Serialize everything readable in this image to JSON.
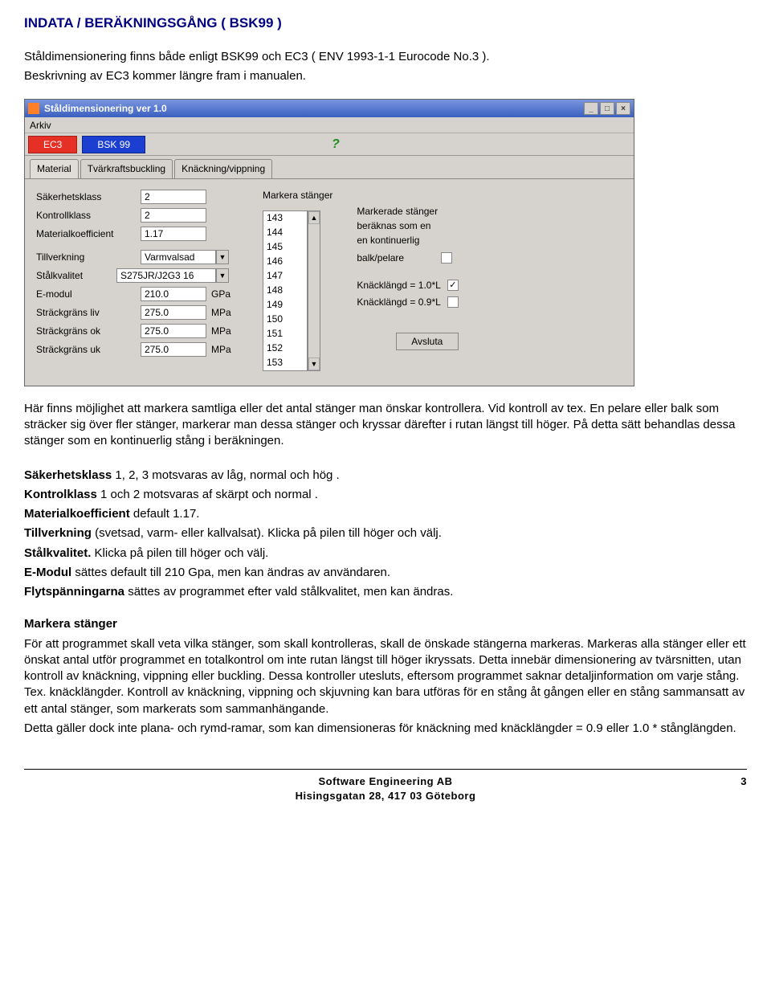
{
  "heading": "INDATA / BERÄKNINGSGÅNG ( BSK99 )",
  "intro": {
    "l1": "Ståldimensionering finns både enligt BSK99 och EC3 ( ENV 1993-1-1 Eurocode No.3 ).",
    "l2": "Beskrivning av EC3 kommer längre fram i manualen."
  },
  "app": {
    "title": "Ståldimensionering ver 1.0",
    "menu": {
      "arkiv": "Arkiv"
    },
    "toolbar": {
      "ec3": "EC3",
      "bsk99": "BSK 99",
      "help": "?"
    },
    "tabs": {
      "material": "Material",
      "tvark": "Tvärkraftsbuckling",
      "knack": "Knäckning/vippning"
    },
    "left": {
      "l1": "Säkerhetsklass",
      "v1": "2",
      "l2": "Kontrollklass",
      "v2": "2",
      "l3": "Materialkoefficient",
      "v3": "1.17",
      "l4": "Tillverkning",
      "v4": "Varmvalsad",
      "l5": "Stålkvalitet",
      "v5": "S275JR/J2G3   16",
      "l6": "E-modul",
      "v6": "210.0",
      "u6": "GPa",
      "l7": "Sträckgräns liv",
      "v7": "275.0",
      "u7": "MPa",
      "l8": "Sträckgräns ok",
      "v8": "275.0",
      "u8": "MPa",
      "l9": "Sträckgräns uk",
      "v9": "275.0",
      "u9": "MPa"
    },
    "list": {
      "label": "Markera stänger",
      "i0": "143",
      "i1": "144",
      "i2": "145",
      "i3": "146",
      "i4": "147",
      "i5": "148",
      "i6": "149",
      "i7": "150",
      "i8": "151",
      "i9": "152",
      "i10": "153"
    },
    "right": {
      "t1": "Markerade stänger",
      "t2": "beräknas som en",
      "t3": "en kontinuerlig",
      "t4": "balk/pelare",
      "c1": "Knäcklängd = 1.0*L",
      "c2": "Knäcklängd = 0.9*L",
      "avsluta": "Avsluta"
    },
    "winbtns": {
      "min": "_",
      "max": "□",
      "close": "×"
    }
  },
  "explain": {
    "p1": "Här finns möjlighet att markera samtliga eller det antal stänger man önskar kontrollera. Vid kontroll av tex. En pelare eller balk som sträcker sig över fler stänger, markerar man dessa stänger och kryssar därefter i rutan längst till höger. På detta sätt behandlas dessa stänger som en kontinuerlig stång i beräkningen."
  },
  "defs": {
    "b1a": "Säkerhetsklass",
    "b1b": " 1, 2, 3 motsvaras av låg, normal och hög .",
    "b2a": "Kontrolklass",
    "b2b": " 1 och 2 motsvaras af skärpt och normal .",
    "b3a": "Materialkoefficient",
    "b3b": " default 1.17.",
    "b4a": "Tillverkning",
    "b4b": " (svetsad, varm- eller kallvalsat). Klicka på pilen till höger och välj.",
    "b5a": "Stålkvalitet.",
    "b5b": " Klicka på pilen till höger och välj.",
    "b6a": "E-Modul",
    "b6b": " sättes default till 210 Gpa, men kan ändras av användaren.",
    "b7a": "Flytspänningarna",
    "b7b": " sättes av programmet efter vald stålkvalitet, men kan ändras."
  },
  "mark": {
    "h": "Markera stänger",
    "p1": "För att programmet skall veta vilka stänger, som skall kontrolleras, skall de önskade stängerna markeras. Markeras alla stänger eller ett önskat antal utför programmet en totalkontrol om inte rutan längst till höger ikryssats. Detta innebär dimensionering av tvärsnitten, utan kontroll av knäckning, vippning eller buckling. Dessa kontroller utesluts, eftersom programmet saknar detaljinformation om varje stång. Tex. knäcklängder. Kontroll av knäckning, vippning och skjuvning kan bara utföras för en stång åt gången eller en stång sammansatt av ett antal stänger, som markerats som sammanhängande.",
    "p2": "Detta gäller dock inte plana- och rymd-ramar, som kan dimensioneras för knäckning med knäcklängder = 0.9 eller 1.0 * stånglängden."
  },
  "footer": {
    "l1": "Software Engineering AB",
    "l2": "Hisingsgatan 28, 417 03 Göteborg",
    "page": "3"
  }
}
